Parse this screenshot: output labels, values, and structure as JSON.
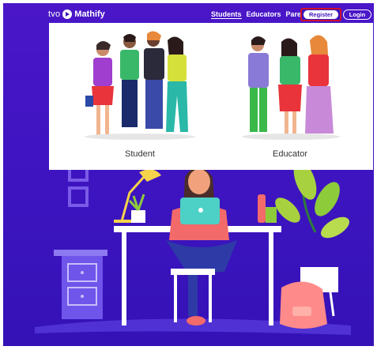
{
  "brand": {
    "prefix": "tvo",
    "name": "Mathify"
  },
  "nav": {
    "links": [
      {
        "label": "Students",
        "active": true
      },
      {
        "label": "Educators",
        "active": false
      },
      {
        "label": "Parents",
        "active": false
      }
    ],
    "register_label": "Register",
    "login_label": "Login"
  },
  "register_menu": {
    "options": [
      {
        "label": "Student"
      },
      {
        "label": "Educator"
      }
    ]
  },
  "colors": {
    "background": "#3d14c0",
    "highlight": "#d0102a",
    "panel": "#ffffff"
  },
  "icons": [
    "tvo-play-logo-icon"
  ]
}
